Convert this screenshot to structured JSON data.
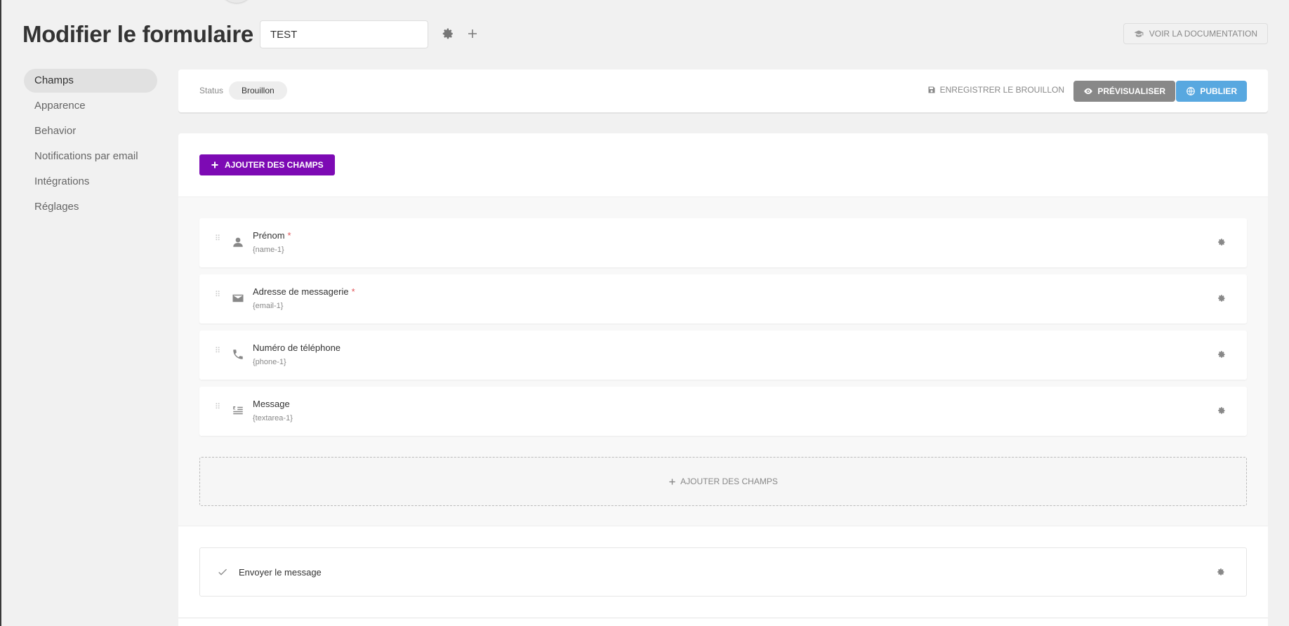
{
  "header": {
    "title": "Modifier le formulaire",
    "form_name": "TEST",
    "doc_button": "VOIR LA DOCUMENTATION"
  },
  "sidebar": {
    "items": [
      {
        "label": "Champs"
      },
      {
        "label": "Apparence"
      },
      {
        "label": "Behavior"
      },
      {
        "label": "Notifications par email"
      },
      {
        "label": "Intégrations"
      },
      {
        "label": "Réglages"
      }
    ],
    "active_index": 0
  },
  "status_bar": {
    "status_label": "Status",
    "status_value": "Brouillon",
    "save_draft": "ENREGISTRER LE BROUILLON",
    "preview": "PRÉVISUALISER",
    "publish": "PUBLIER"
  },
  "builder": {
    "add_fields_top": "AJOUTER DES CHAMPS",
    "fields": [
      {
        "label": "Prénom",
        "required": "*",
        "tag": "{name-1}",
        "icon": "user-icon"
      },
      {
        "label": "Adresse de messagerie",
        "required": "*",
        "tag": "{email-1}",
        "icon": "envelope-icon"
      },
      {
        "label": "Numéro de téléphone",
        "tag": "{phone-1}",
        "icon": "phone-icon"
      },
      {
        "label": "Message",
        "tag": "{textarea-1}",
        "icon": "textarea-icon"
      }
    ],
    "add_fields_bottom": "AJOUTER DES CHAMPS",
    "submit_label": "Envoyer le message"
  },
  "colors": {
    "accent_purple": "#7d0ab4",
    "publish_blue": "#58a8e0",
    "preview_gray": "#888888",
    "required_red": "#e1555a"
  }
}
